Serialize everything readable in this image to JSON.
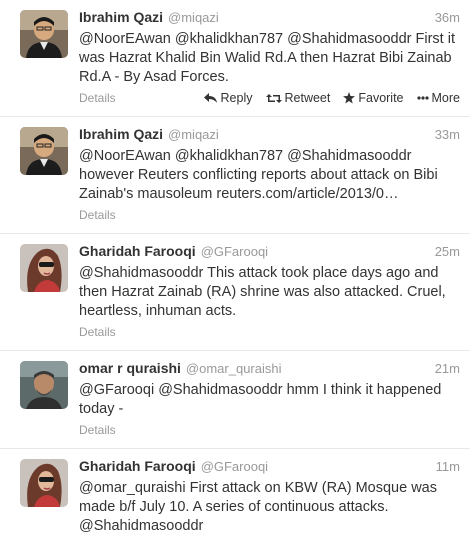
{
  "footer_labels": {
    "details": "Details",
    "reply": "Reply",
    "retweet": "Retweet",
    "favorite": "Favorite",
    "more": "More"
  },
  "tweets": [
    {
      "fullname": "Ibrahim Qazi",
      "username": "@miqazi",
      "time": "36m",
      "text": "@NoorEAwan @khalidkhan787 @Shahidmasooddr First it was Hazrat Khalid Bin Walid Rd.A then Hazrat Bibi Zainab Rd.A - By Asad Forces."
    },
    {
      "fullname": "Ibrahim Qazi",
      "username": "@miqazi",
      "time": "33m",
      "text": "@NoorEAwan @khalidkhan787 @Shahidmasooddr however Reuters conflicting reports about attack on Bibi Zainab's mausoleum reuters.com/article/2013/0…"
    },
    {
      "fullname": "Gharidah Farooqi",
      "username": "@GFarooqi",
      "time": "25m",
      "text": "@Shahidmasooddr This attack took place days ago and then Hazrat Zainab (RA) shrine was also attacked. Cruel, heartless, inhuman acts."
    },
    {
      "fullname": "omar r quraishi",
      "username": "@omar_quraishi",
      "time": "21m",
      "text": "@GFarooqi @Shahidmasooddr hmm I think it happened today -"
    },
    {
      "fullname": "Gharidah Farooqi",
      "username": "@GFarooqi",
      "time": "11m",
      "text": "@omar_quraishi First attack on KBW (RA) Mosque was made b/f July 10. A series of continuous attacks. @Shahidmasooddr"
    }
  ]
}
